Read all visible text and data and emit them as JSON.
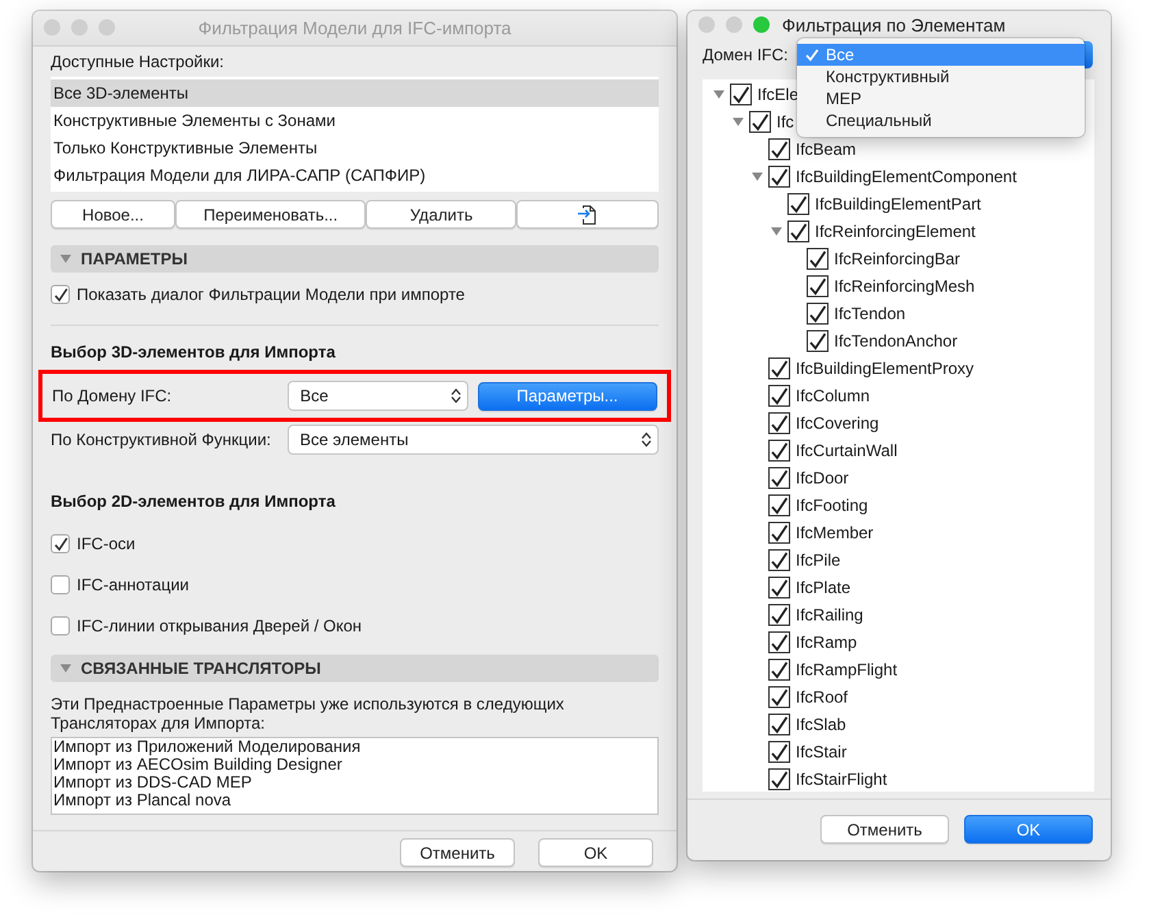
{
  "left_window": {
    "title": "Фильтрация Модели для IFC-импорта",
    "traffic_lights": [
      {
        "color": "#cfcfcf"
      },
      {
        "color": "#cfcfcf"
      },
      {
        "color": "#cfcfcf"
      }
    ],
    "presets": {
      "label": "Доступные Настройки:",
      "items": [
        {
          "text": "Все 3D-элементы",
          "selected": true
        },
        {
          "text": "Конструктивные Элементы с Зонами",
          "selected": false
        },
        {
          "text": "Только Конструктивные Элементы",
          "selected": false
        },
        {
          "text": "Фильтрация Модели для ЛИРА-САПР (САПФИР)",
          "selected": false
        }
      ]
    },
    "preset_buttons": [
      {
        "kind": "text",
        "label": "Новое..."
      },
      {
        "kind": "text",
        "label": "Переименовать..."
      },
      {
        "kind": "text",
        "label": "Удалить"
      },
      {
        "kind": "icon"
      }
    ],
    "parameters_section": {
      "title": "ПАРАМЕТРЫ",
      "expanded": true,
      "checkbox": {
        "label": "Показать диалог Фильтрации Модели при импорте",
        "checked": true
      }
    },
    "selection_3d": {
      "heading": "Выбор 3D-элементов для Импорта",
      "rows": [
        {
          "label": "По Домену IFC:",
          "value": "Все",
          "button": "Параметры...",
          "highlighted": true
        },
        {
          "label": "По Конструктивной Функции:",
          "value": "Все элементы",
          "highlighted": false
        }
      ]
    },
    "selection_2d": {
      "heading": "Выбор 2D-элементов для Импорта",
      "options": [
        {
          "label": "IFC-оси",
          "checked": true
        },
        {
          "label": "IFC-аннотации",
          "checked": false
        },
        {
          "label": "IFC-линии открывания Дверей / Окон",
          "checked": false
        }
      ]
    },
    "translators_section": {
      "title": "СВЯЗАННЫЕ ТРАНСЛЯТОРЫ",
      "expanded": true,
      "note": "Эти Преднастроенные Параметры уже используются в следующих Трансляторах для Импорта:",
      "items": [
        "Импорт из Приложений Моделирования",
        "Импорт из AECOsim Building Designer",
        "Импорт из DDS-CAD MEP",
        "Импорт из Plancal nova"
      ]
    },
    "buttons": [
      {
        "label": "Отменить",
        "default": false
      },
      {
        "label": "OK",
        "default": false
      }
    ]
  },
  "right_window": {
    "title": "Фильтрация по Элементам",
    "traffic_lights": [
      {
        "color": "#cfcfcf"
      },
      {
        "color": "#cfcfcf"
      },
      {
        "color": "#27c93f"
      }
    ],
    "domain": {
      "label": "Домен IFC:",
      "menu": [
        {
          "text": "Все",
          "selected": true
        },
        {
          "text": "Конструктивный",
          "selected": false
        },
        {
          "text": "MEP",
          "selected": false
        },
        {
          "text": "Специальный",
          "selected": false
        }
      ]
    },
    "tree": [
      {
        "label": "IfcEle",
        "checked": true,
        "expanded": true,
        "children": [
          {
            "label": "Ifc",
            "checked": true,
            "expanded": true,
            "children": [
              {
                "label": "IfcBeam",
                "checked": true
              },
              {
                "label": "IfcBuildingElementComponent",
                "checked": true,
                "expanded": true,
                "children": [
                  {
                    "label": "IfcBuildingElementPart",
                    "checked": true
                  },
                  {
                    "label": "IfcReinforcingElement",
                    "checked": true,
                    "expanded": true,
                    "children": [
                      {
                        "label": "IfcReinforcingBar",
                        "checked": true
                      },
                      {
                        "label": "IfcReinforcingMesh",
                        "checked": true
                      },
                      {
                        "label": "IfcTendon",
                        "checked": true
                      },
                      {
                        "label": "IfcTendonAnchor",
                        "checked": true
                      }
                    ]
                  }
                ]
              },
              {
                "label": "IfcBuildingElementProxy",
                "checked": true
              },
              {
                "label": "IfcColumn",
                "checked": true
              },
              {
                "label": "IfcCovering",
                "checked": true
              },
              {
                "label": "IfcCurtainWall",
                "checked": true
              },
              {
                "label": "IfcDoor",
                "checked": true
              },
              {
                "label": "IfcFooting",
                "checked": true
              },
              {
                "label": "IfcMember",
                "checked": true
              },
              {
                "label": "IfcPile",
                "checked": true
              },
              {
                "label": "IfcPlate",
                "checked": true
              },
              {
                "label": "IfcRailing",
                "checked": true
              },
              {
                "label": "IfcRamp",
                "checked": true
              },
              {
                "label": "IfcRampFlight",
                "checked": true
              },
              {
                "label": "IfcRoof",
                "checked": true
              },
              {
                "label": "IfcSlab",
                "checked": true
              },
              {
                "label": "IfcStair",
                "checked": true
              },
              {
                "label": "IfcStairFlight",
                "checked": true
              }
            ]
          }
        ]
      }
    ],
    "buttons": [
      {
        "label": "Отменить",
        "default": false
      },
      {
        "label": "OK",
        "default": true
      }
    ]
  }
}
